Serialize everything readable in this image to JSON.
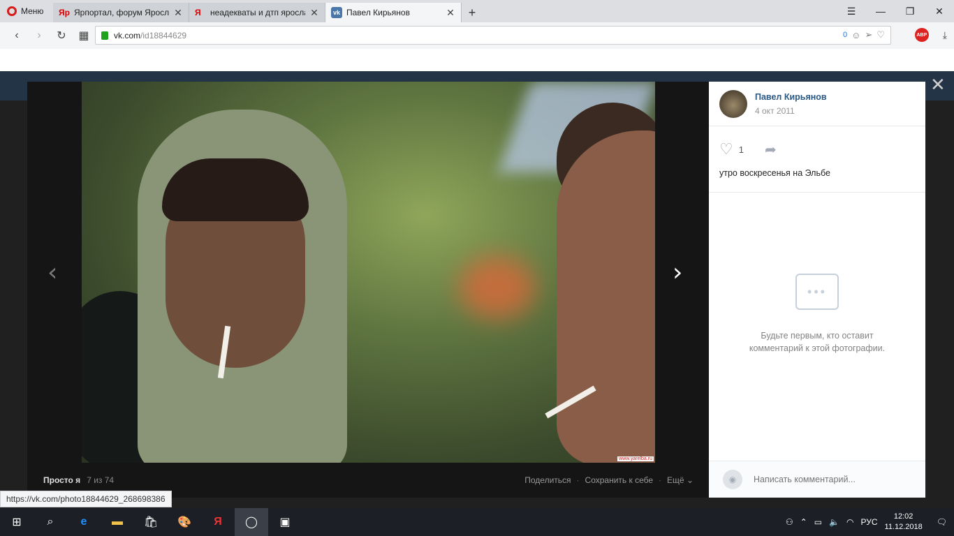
{
  "browser": {
    "menu_label": "Меню",
    "tabs": [
      {
        "label": "Ярпортал, форум Яросла",
        "favicon": "Яр"
      },
      {
        "label": "неадекваты и дтп яросла",
        "favicon": "Я"
      },
      {
        "label": "Павел Кирьянов",
        "favicon": "vk"
      }
    ],
    "url_host": "vk.com",
    "url_path": "/id18844629",
    "blocked_count": "0",
    "status_url": "https://vk.com/photo18844629_268698386"
  },
  "viewer": {
    "album": "Просто я",
    "counter": "7 из 74",
    "actions": [
      "Поделиться",
      "Сохранить к себе",
      "Ещё"
    ],
    "watermark": "www.yarelba.ru"
  },
  "side": {
    "author": "Павел Кирьянов",
    "date": "4 окт 2011",
    "likes": "1",
    "caption": "утро воскресенья на Эльбе",
    "empty_line1": "Будьте первым, кто оставит",
    "empty_line2": "комментарий к этой фотографии.",
    "comment_placeholder": "Написать комментарий..."
  },
  "taskbar": {
    "lang": "РУС",
    "time": "12:02",
    "date": "11.12.2018"
  }
}
